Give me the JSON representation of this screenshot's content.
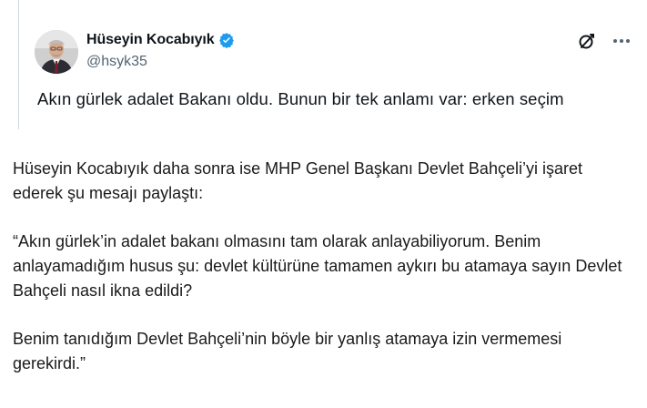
{
  "tweet": {
    "author_name": "Hüseyin Kocabıyık",
    "handle": "@hsyk35",
    "text": "Akın gürlek adalet Bakanı oldu. Bunun bir tek anlamı var: erken seçim",
    "icons": {
      "verified": "verified-badge-icon",
      "brand": "x-logo-icon",
      "more": "more-options-icon"
    },
    "colors": {
      "verified": "#1d9bf0",
      "handle": "#536471",
      "border": "#cfd9de"
    }
  },
  "article": {
    "paragraphs": [
      "Hüseyin Kocabıyık daha sonra ise MHP Genel Başkanı Devlet Bahçeli’yi işaret ederek şu mesajı paylaştı:",
      "“Akın gürlek’in adalet bakanı olmasını tam olarak anlayabiliyorum. Benim anlayamadığım husus şu: devlet kültürüne tamamen aykırı bu atamaya sayın Devlet Bahçeli nasıl ikna edildi?",
      "Benim tanıdığım Devlet Bahçeli’nin böyle bir yanlış atamaya izin vermemesi gerekirdi.”"
    ]
  }
}
